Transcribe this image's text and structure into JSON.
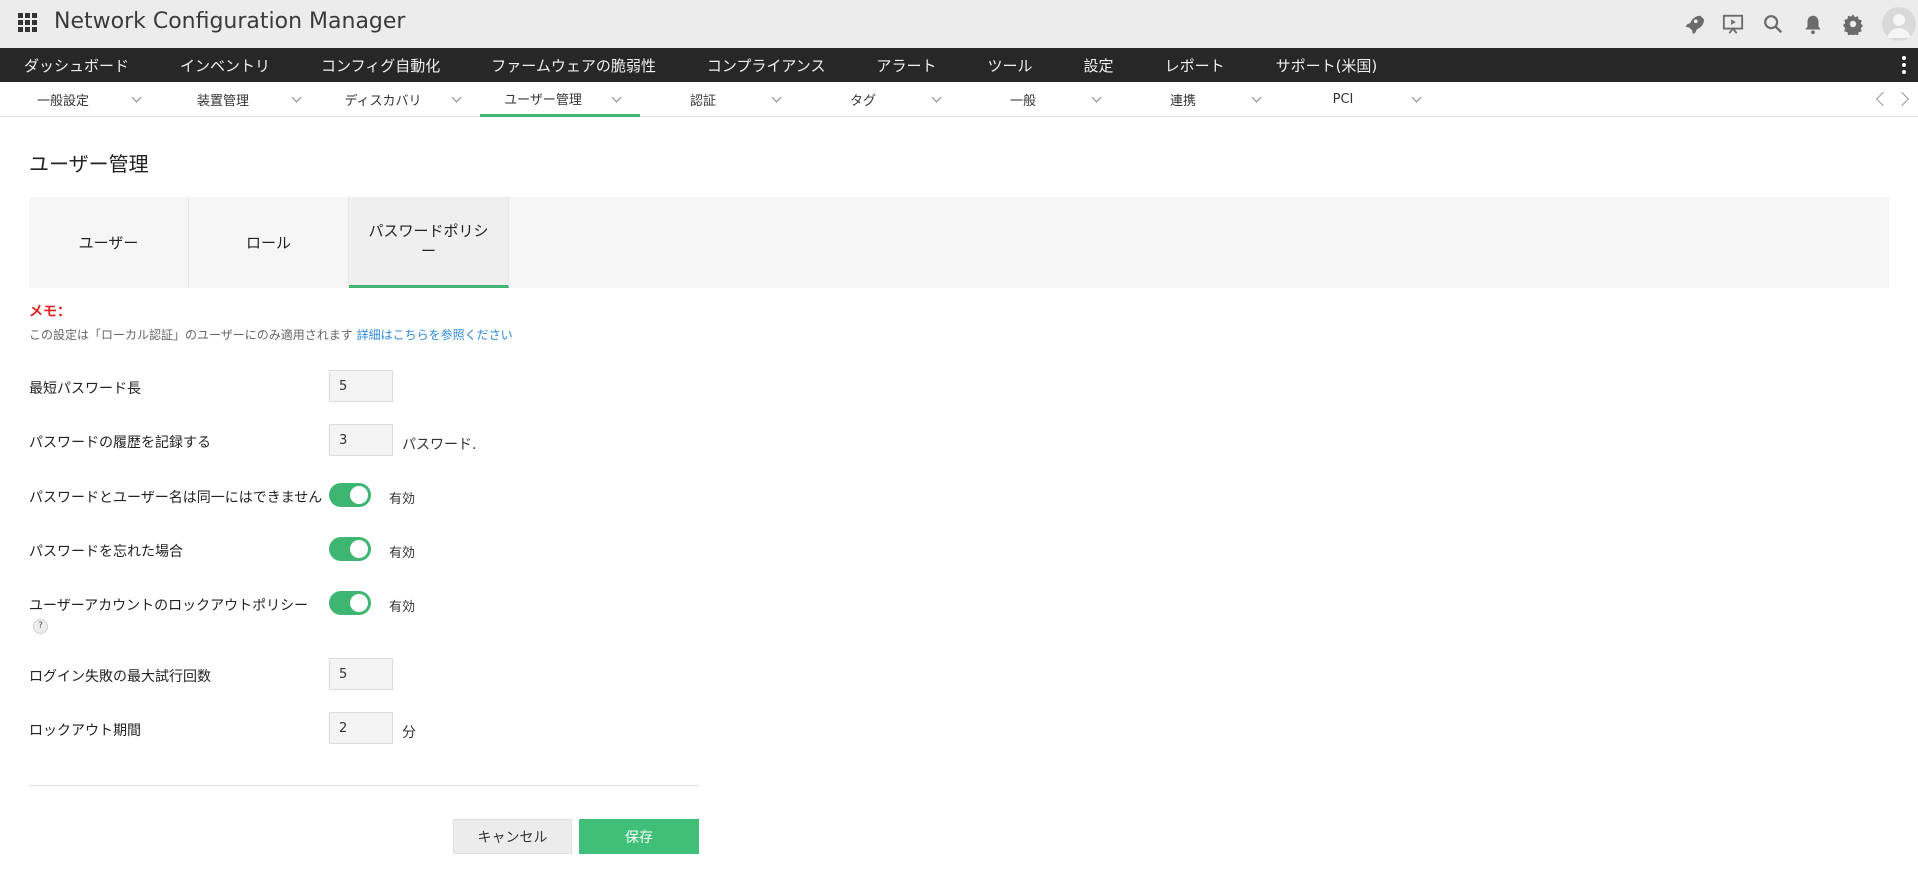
{
  "app": {
    "title": "Network Configuration Manager"
  },
  "header_icons": [
    "rocket-icon",
    "presentation-icon",
    "search-icon",
    "bell-icon",
    "gear-icon",
    "avatar-icon"
  ],
  "main_nav": {
    "items": [
      {
        "label": "ダッシュボード"
      },
      {
        "label": "インベントリ"
      },
      {
        "label": "コンフィグ自動化"
      },
      {
        "label": "ファームウェアの脆弱性"
      },
      {
        "label": "コンプライアンス"
      },
      {
        "label": "アラート"
      },
      {
        "label": "ツール"
      },
      {
        "label": "設定"
      },
      {
        "label": "レポート"
      },
      {
        "label": "サポート(米国)"
      }
    ]
  },
  "sub_nav": {
    "items": [
      {
        "label": "一般設定"
      },
      {
        "label": "装置管理"
      },
      {
        "label": "ディスカバリ"
      },
      {
        "label": "ユーザー管理",
        "active": true
      },
      {
        "label": "認証"
      },
      {
        "label": "タグ"
      },
      {
        "label": "一般"
      },
      {
        "label": "連携"
      },
      {
        "label": "PCI"
      }
    ]
  },
  "page": {
    "title": "ユーザー管理"
  },
  "tabs": [
    {
      "label": "ユーザー"
    },
    {
      "label": "ロール"
    },
    {
      "label": "パスワードポリシー",
      "active": true
    }
  ],
  "memo": {
    "label": "メモ：",
    "text": "この設定は「ローカル認証」のユーザーにのみ適用されます",
    "link": "詳細はこちらを参照ください"
  },
  "form": {
    "min_length": {
      "label": "最短パスワード長",
      "value": "5"
    },
    "history": {
      "label": "パスワードの履歴を記録する",
      "value": "3",
      "suffix": "パスワード."
    },
    "username_same": {
      "label": "パスワードとユーザー名は同一にはできません",
      "state": "有効",
      "enabled": true
    },
    "forgot": {
      "label": "パスワードを忘れた場合",
      "state": "有効",
      "enabled": true
    },
    "lockout_policy": {
      "label": "ユーザーアカウントのロックアウトポリシー",
      "state": "有効",
      "enabled": true,
      "help": "?"
    },
    "max_attempts": {
      "label": "ログイン失敗の最大試行回数",
      "value": "5"
    },
    "lockout_period": {
      "label": "ロックアウト期間",
      "value": "2",
      "suffix": "分"
    }
  },
  "buttons": {
    "cancel": "キャンセル",
    "save": "保存"
  },
  "colors": {
    "accent": "#3fb572",
    "memo": "#e2211c",
    "link": "#2e8ad8",
    "nav_bg": "#272727"
  }
}
